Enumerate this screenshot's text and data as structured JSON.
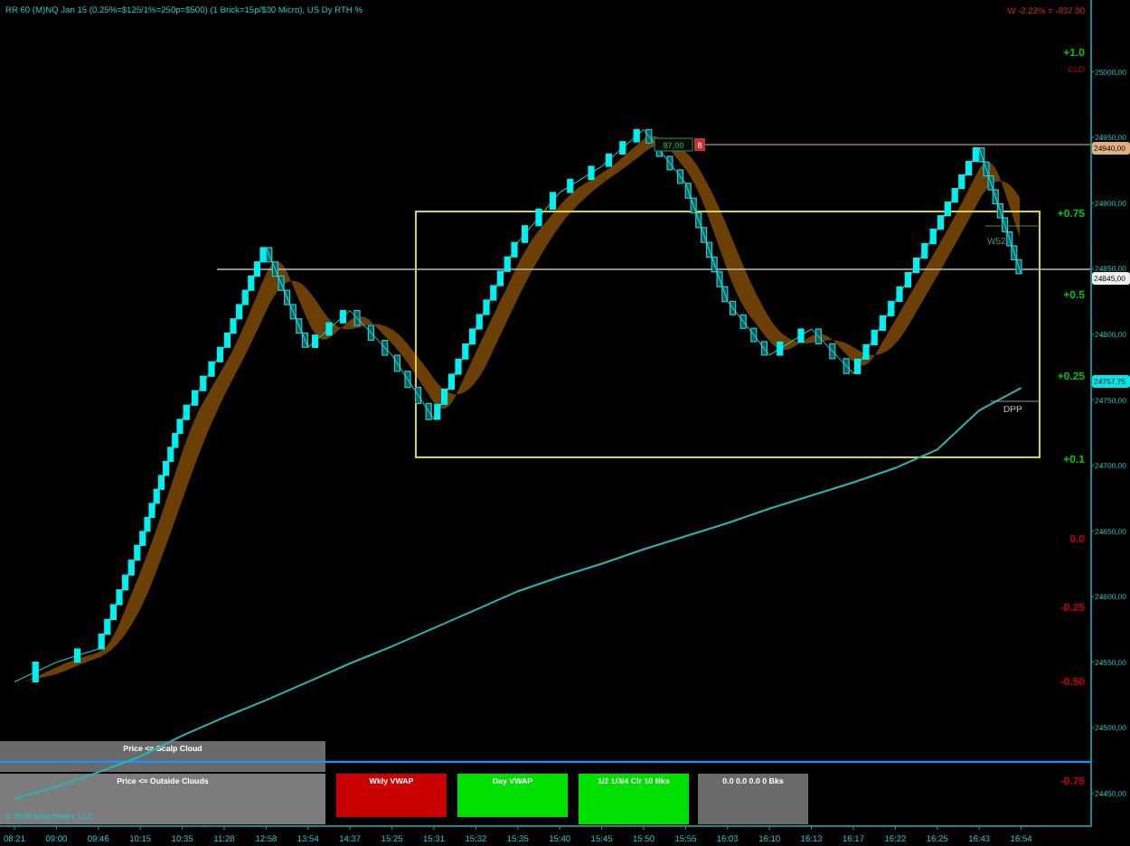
{
  "header": {
    "title": "RR 60 (M)NQ Jan 15 (0.25%=$125/1%=250p=$500) (1 Brick=15p/$30 Micro), US Dy RTH %",
    "pnl": "W -2.22% = -837.00",
    "corner_label": "CLO"
  },
  "chart": {
    "chart_data": {
      "type": "line",
      "categories": [
        "08:21",
        "09:00",
        "09:46",
        "10:15",
        "10:35",
        "11:28",
        "12:58",
        "13:54",
        "14:37",
        "15:25",
        "15:31",
        "15:32",
        "15:35",
        "15:40",
        "15:45",
        "15:50",
        "15:55",
        "16:03",
        "16:10",
        "16:13",
        "16:17",
        "16:22",
        "16:25",
        "16:43",
        "16:54"
      ],
      "yticks": [
        {
          "value": 25000,
          "label": "25000,00"
        },
        {
          "value": 24950,
          "label": "24950,00"
        },
        {
          "value": 24900,
          "label": "24900,00"
        },
        {
          "value": 24850,
          "label": "24850,00"
        },
        {
          "value": 24800,
          "label": "24800,00"
        },
        {
          "value": 24750,
          "label": "24750,00"
        },
        {
          "value": 24700,
          "label": "24700,00"
        },
        {
          "value": 24650,
          "label": "24650,00"
        },
        {
          "value": 24600,
          "label": "24600,00"
        },
        {
          "value": 24550,
          "label": "24550,00"
        },
        {
          "value": 24500,
          "label": "24500,00"
        },
        {
          "value": 24450,
          "label": "24450,00"
        }
      ],
      "ylim": [
        24425,
        25052
      ],
      "ref_lines": [
        {
          "axis": "y",
          "value": 24474,
          "color": "#1e90ff"
        }
      ],
      "series": [
        {
          "color": "#00f0f0",
          "values": [
            24535,
            24550,
            24560,
            24639,
            24735,
            24790,
            24866,
            24790,
            24818,
            24784,
            24735,
            24804,
            24870,
            24908,
            24928,
            24956,
            24915,
            24825,
            24784,
            24804,
            24770,
            24825,
            24880,
            24942,
            24846
          ]
        },
        {
          "color": "#20b8b8",
          "values": [
            24446,
            24455,
            24466,
            24478,
            24494,
            24508,
            24521,
            24535,
            24549,
            24562,
            24576,
            24590,
            24604,
            24615,
            24625,
            24636,
            24646,
            24656,
            24667,
            24677,
            24687,
            24698,
            24712,
            24742,
            24759
          ]
        }
      ]
    },
    "price_labels": [
      {
        "text": "24940,00",
        "kind": "level"
      },
      {
        "text": "24845,00",
        "kind": "pivot"
      },
      {
        "text": "24757,75",
        "kind": "vwap"
      }
    ],
    "level_labels": [
      {
        "text": "+1.0",
        "color": "#00c000"
      },
      {
        "text": "+0.75",
        "color": "#00c000"
      },
      {
        "text": "+0.5",
        "color": "#00c000"
      },
      {
        "text": "+0.25",
        "color": "#00c000"
      },
      {
        "text": "+0.1",
        "color": "#00c000"
      },
      {
        "text": "0.0",
        "color": "#c00000"
      },
      {
        "text": "-0.25",
        "color": "#c00000"
      },
      {
        "text": "-0.50",
        "color": "#c00000"
      },
      {
        "text": "-0.75",
        "color": "#c00000"
      }
    ],
    "trade_marker": {
      "text": "97,00",
      "button": "8"
    },
    "line_labels": [
      "W52",
      "DPP"
    ]
  },
  "panels": [
    {
      "text": "Price <= Scalp Cloud",
      "color": "#6a6a6a"
    },
    {
      "text": "Price <= Outside Clouds",
      "color": "#7c7c7c"
    },
    {
      "text": "Wkly VWAP",
      "color": "#c80000"
    },
    {
      "text": "Day VWAP",
      "color": "#00e000"
    },
    {
      "text": "1/2 1/3/4 Clr 10 Bks",
      "color": "#00e000"
    },
    {
      "text": "0.0 0.0 0.0 0 Bks",
      "color": "#6a6a6a"
    }
  ],
  "copyright": "© 2026 NinjaTrader, LLC"
}
